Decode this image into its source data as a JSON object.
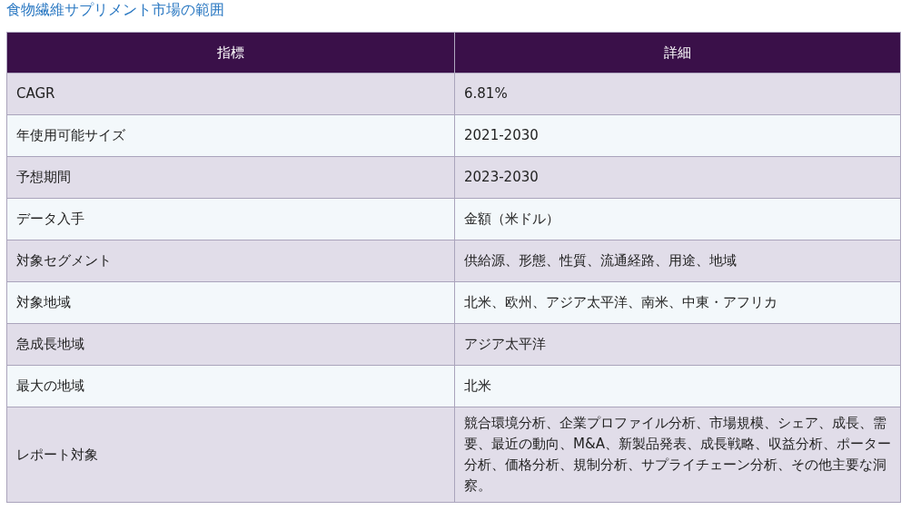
{
  "title": "食物繊維サプリメント市場の範囲",
  "table": {
    "columns": [
      "指標",
      "詳細"
    ],
    "rows": [
      {
        "cells": [
          "CAGR",
          "6.81%"
        ]
      },
      {
        "cells": [
          "年使用可能サイズ",
          "2021-2030"
        ]
      },
      {
        "cells": [
          "予想期間",
          "2023-2030"
        ]
      },
      {
        "cells": [
          "データ入手",
          "金額（米ドル）"
        ]
      },
      {
        "cells": [
          "対象セグメント",
          "供給源、形態、性質、流通経路、用途、地域"
        ]
      },
      {
        "cells": [
          "対象地域",
          "北米、欧州、アジア太平洋、南米、中東・アフリカ"
        ]
      },
      {
        "cells": [
          "急成長地域",
          "アジア太平洋"
        ]
      },
      {
        "cells": [
          "最大の地域",
          "北米"
        ]
      },
      {
        "cells": [
          "レポート対象",
          "競合環境分析、企業プロファイル分析、市場規模、シェア、成長、需要、最近の動向、M&A、新製品発表、成長戦略、収益分析、ポーター分析、価格分析、規制分析、サプライチェーン分析、その他主要な洞察。"
        ]
      }
    ]
  }
}
